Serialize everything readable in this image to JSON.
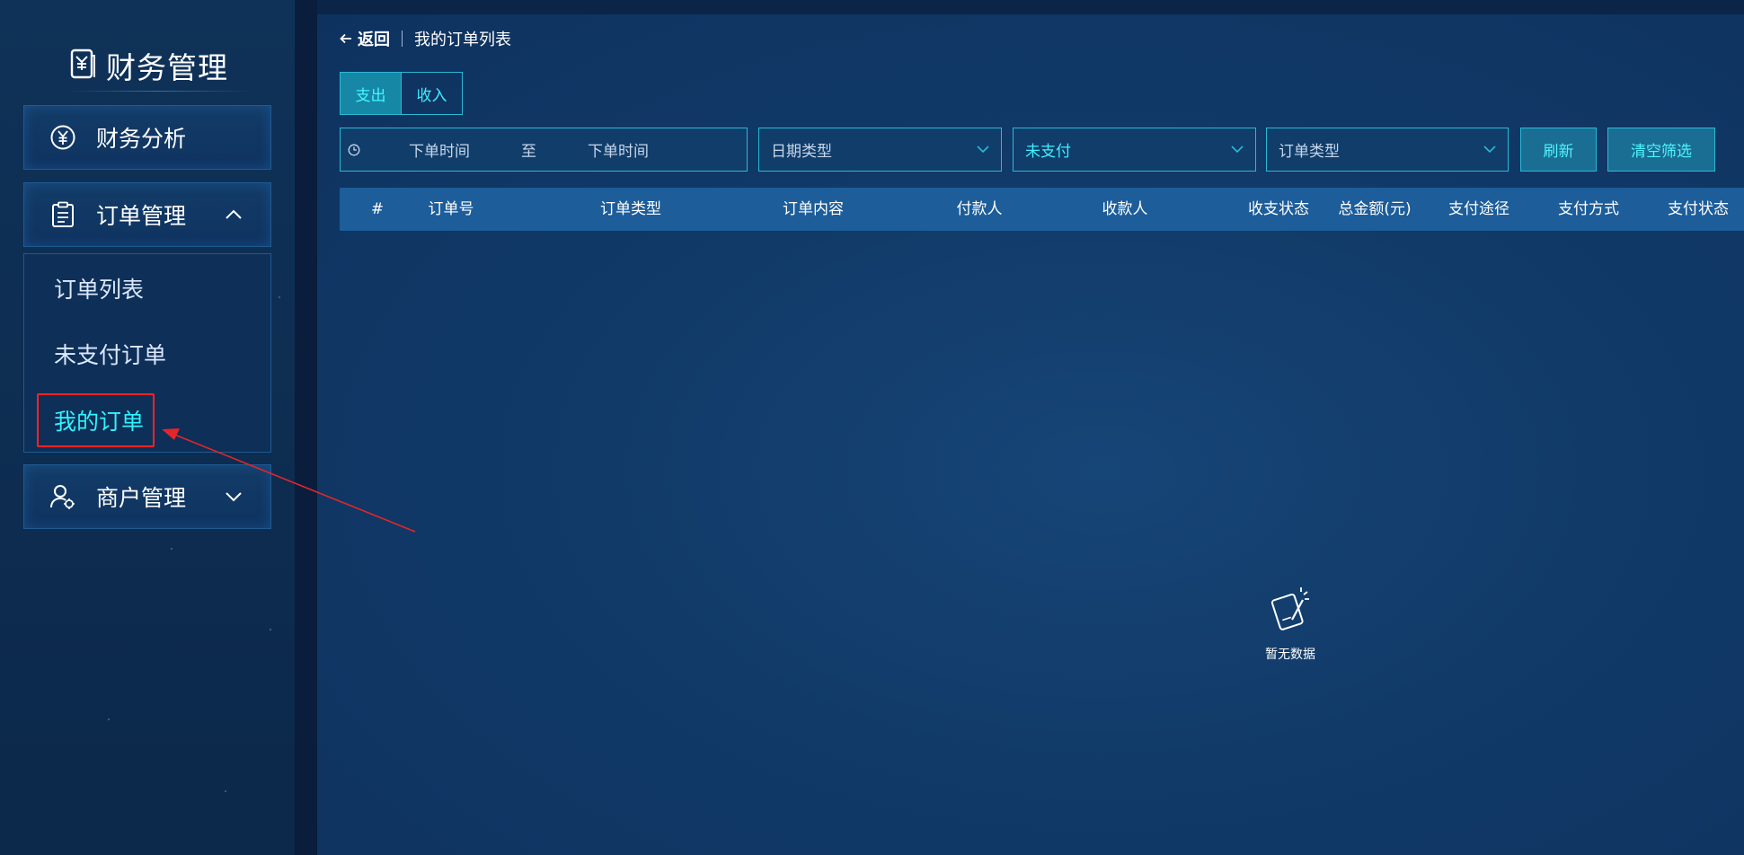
{
  "sidebar": {
    "brand_title": "财务管理",
    "items": [
      {
        "label": "财务分析",
        "icon": "yen-circle-icon"
      },
      {
        "label": "订单管理",
        "icon": "clipboard-icon",
        "expanded": true
      },
      {
        "label": "商户管理",
        "icon": "merchant-user-icon",
        "expanded": false
      }
    ],
    "order_submenu": [
      {
        "label": "订单列表"
      },
      {
        "label": "未支付订单"
      },
      {
        "label": "我的订单",
        "active": true
      }
    ]
  },
  "breadcrumb": {
    "back_label": "返回",
    "title": "我的订单列表"
  },
  "tabs": [
    {
      "label": "支出",
      "active": true
    },
    {
      "label": "收入",
      "active": false
    }
  ],
  "filters": {
    "date_start_placeholder": "下单时间",
    "date_separator": "至",
    "date_end_placeholder": "下单时间",
    "date_type_placeholder": "日期类型",
    "pay_status_value": "未支付",
    "order_type_placeholder": "订单类型"
  },
  "buttons": {
    "refresh": "刷新",
    "clear": "清空筛选"
  },
  "table": {
    "columns": [
      "#",
      "订单号",
      "订单类型",
      "订单内容",
      "付款人",
      "收款人",
      "收支状态",
      "总金额(元)",
      "支付途径",
      "支付方式",
      "支付状态"
    ],
    "empty_text": "暂无数据"
  },
  "colors": {
    "accent": "#2ff3ff",
    "annotation": "#ff2323",
    "header_row": "#1c5d9a"
  }
}
